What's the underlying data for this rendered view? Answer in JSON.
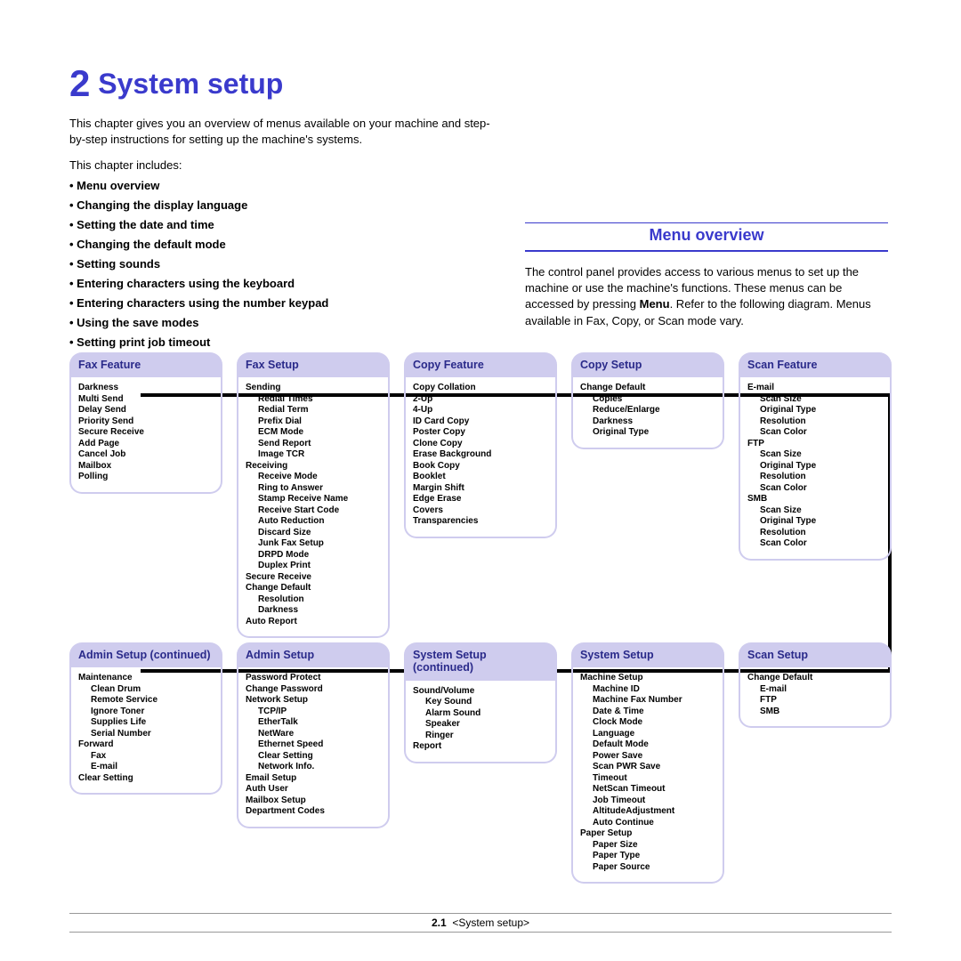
{
  "chapter": {
    "number": "2",
    "title": "System setup"
  },
  "intro": "This chapter gives you an overview of menus available on your machine and step-by-step instructions for setting up the machine's systems.",
  "toc_label": "This chapter includes:",
  "toc": [
    "Menu overview",
    "Changing the display language",
    "Setting the date and time",
    "Changing the default mode",
    "Setting sounds",
    "Entering characters using the keyboard",
    "Entering characters using the number keypad",
    "Using the save modes",
    "Setting print job timeout"
  ],
  "section": {
    "heading": "Menu overview",
    "body_pre": "The control panel provides access to various menus to set up the machine or use the machine's functions. These menus can be accessed by pressing ",
    "body_bold": "Menu",
    "body_post": ". Refer to the following diagram. Menus available in Fax, Copy, or Scan mode vary."
  },
  "row1": [
    {
      "title": "Fax Feature",
      "items": [
        [
          "Darkness",
          0
        ],
        [
          "Multi Send",
          0
        ],
        [
          "Delay Send",
          0
        ],
        [
          "Priority Send",
          0
        ],
        [
          "Secure Receive",
          0
        ],
        [
          "Add Page",
          0
        ],
        [
          "Cancel Job",
          0
        ],
        [
          "Mailbox",
          0
        ],
        [
          "Polling",
          0
        ]
      ]
    },
    {
      "title": "Fax Setup",
      "items": [
        [
          "Sending",
          0
        ],
        [
          "Redial Times",
          1
        ],
        [
          "Redial Term",
          1
        ],
        [
          "Prefix Dial",
          1
        ],
        [
          "ECM Mode",
          1
        ],
        [
          "Send Report",
          1
        ],
        [
          "Image TCR",
          1
        ],
        [
          "Receiving",
          0
        ],
        [
          "Receive Mode",
          1
        ],
        [
          "Ring to Answer",
          1
        ],
        [
          "Stamp Receive Name",
          1
        ],
        [
          "Receive Start Code",
          1
        ],
        [
          "Auto Reduction",
          1
        ],
        [
          "Discard Size",
          1
        ],
        [
          "Junk Fax Setup",
          1
        ],
        [
          "DRPD Mode",
          1
        ],
        [
          "Duplex Print",
          1
        ],
        [
          "Secure Receive",
          0
        ],
        [
          "Change Default",
          0
        ],
        [
          "Resolution",
          1
        ],
        [
          "Darkness",
          1
        ],
        [
          "Auto Report",
          0
        ]
      ]
    },
    {
      "title": "Copy Feature",
      "items": [
        [
          "Copy Collation",
          0
        ],
        [
          "2-Up",
          0
        ],
        [
          "4-Up",
          0
        ],
        [
          "ID Card Copy",
          0
        ],
        [
          "Poster Copy",
          0
        ],
        [
          "Clone Copy",
          0
        ],
        [
          "Erase Background",
          0
        ],
        [
          "Book Copy",
          0
        ],
        [
          "Booklet",
          0
        ],
        [
          "Margin Shift",
          0
        ],
        [
          "Edge Erase",
          0
        ],
        [
          "Covers",
          0
        ],
        [
          "Transparencies",
          0
        ]
      ]
    },
    {
      "title": "Copy Setup",
      "items": [
        [
          "Change Default",
          0
        ],
        [
          "Copies",
          1
        ],
        [
          "Reduce/Enlarge",
          1
        ],
        [
          "Darkness",
          1
        ],
        [
          "Original Type",
          1
        ]
      ]
    },
    {
      "title": "Scan Feature",
      "items": [
        [
          "E-mail",
          0
        ],
        [
          "Scan Size",
          1
        ],
        [
          "Original Type",
          1
        ],
        [
          "Resolution",
          1
        ],
        [
          "Scan Color",
          1
        ],
        [
          "FTP",
          0
        ],
        [
          "Scan Size",
          1
        ],
        [
          "Original Type",
          1
        ],
        [
          "Resolution",
          1
        ],
        [
          "Scan Color",
          1
        ],
        [
          "SMB",
          0
        ],
        [
          "Scan Size",
          1
        ],
        [
          "Original Type",
          1
        ],
        [
          "Resolution",
          1
        ],
        [
          "Scan Color",
          1
        ]
      ]
    }
  ],
  "row2": [
    {
      "title": "Admin Setup (continued)",
      "items": [
        [
          "Maintenance",
          0
        ],
        [
          "Clean Drum",
          1
        ],
        [
          "Remote Service",
          1
        ],
        [
          "Ignore Toner",
          1
        ],
        [
          "Supplies Life",
          1
        ],
        [
          "Serial Number",
          1
        ],
        [
          "Forward",
          0
        ],
        [
          "Fax",
          1
        ],
        [
          "E-mail",
          1
        ],
        [
          "Clear Setting",
          0
        ]
      ]
    },
    {
      "title": "Admin Setup",
      "items": [
        [
          "Password Protect",
          0
        ],
        [
          "Change Password",
          0
        ],
        [
          "Network Setup",
          0
        ],
        [
          "TCP/IP",
          1
        ],
        [
          "EtherTalk",
          1
        ],
        [
          "NetWare",
          1
        ],
        [
          "Ethernet Speed",
          1
        ],
        [
          "Clear Setting",
          1
        ],
        [
          "Network Info.",
          1
        ],
        [
          "Email Setup",
          0
        ],
        [
          "Auth User",
          0
        ],
        [
          "Mailbox Setup",
          0
        ],
        [
          "Department Codes",
          0
        ]
      ]
    },
    {
      "title": "System Setup (continued)",
      "items": [
        [
          "Sound/Volume",
          0
        ],
        [
          "Key Sound",
          1
        ],
        [
          "Alarm Sound",
          1
        ],
        [
          "Speaker",
          1
        ],
        [
          "Ringer",
          1
        ],
        [
          "Report",
          0
        ]
      ]
    },
    {
      "title": "System Setup",
      "items": [
        [
          "Machine Setup",
          0
        ],
        [
          "Machine ID",
          1
        ],
        [
          "Machine Fax Number",
          1
        ],
        [
          "Date & Time",
          1
        ],
        [
          "Clock Mode",
          1
        ],
        [
          "Language",
          1
        ],
        [
          "Default Mode",
          1
        ],
        [
          "Power Save",
          1
        ],
        [
          "Scan PWR Save",
          1
        ],
        [
          "Timeout",
          1
        ],
        [
          "NetScan Timeout",
          1
        ],
        [
          "Job Timeout",
          1
        ],
        [
          "AltitudeAdjustment",
          1
        ],
        [
          "Auto Continue",
          1
        ],
        [
          "Paper Setup",
          0
        ],
        [
          "Paper Size",
          1
        ],
        [
          "Paper Type",
          1
        ],
        [
          "Paper Source",
          1
        ]
      ]
    },
    {
      "title": "Scan Setup",
      "items": [
        [
          "Change Default",
          0
        ],
        [
          "E-mail",
          1
        ],
        [
          "FTP",
          1
        ],
        [
          "SMB",
          1
        ]
      ]
    }
  ],
  "footer": {
    "page": "2.1",
    "label": "<System setup>"
  }
}
